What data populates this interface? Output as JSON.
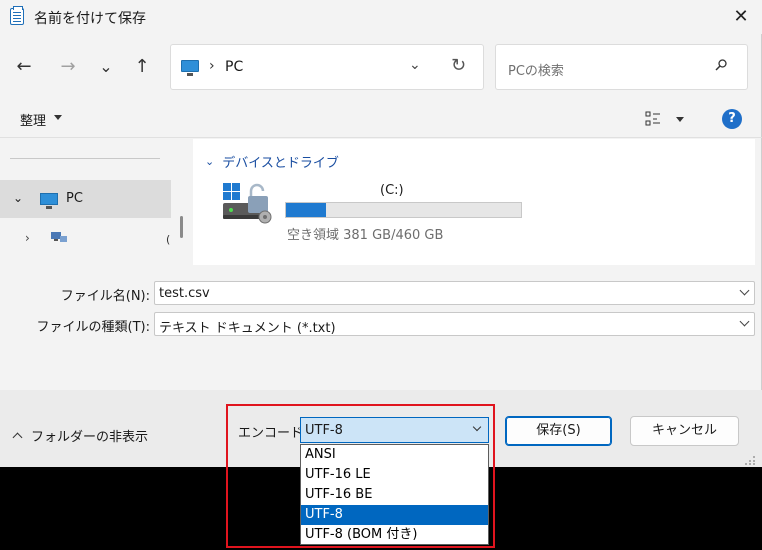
{
  "window": {
    "title": "名前を付けて保存",
    "close_glyph": "✕"
  },
  "nav": {
    "back_glyph": "←",
    "forward_glyph": "→",
    "recent_glyph": "⌄",
    "up_glyph": "↑",
    "address_separator": "›",
    "address_path": "PC",
    "address_dropdown_glyph": "⌄",
    "refresh_glyph": "↻",
    "search_placeholder": "PCの検索"
  },
  "commandbar": {
    "organize_label": "整理",
    "help_label": "?"
  },
  "navpane": {
    "pc_label": "PC",
    "expanded_glyph": "⌄",
    "collapsed_glyph": "›",
    "network_clip": "("
  },
  "content": {
    "group_label": "デバイスとドライブ",
    "group_glyph": "⌄",
    "drive_name": "(C:)",
    "drive_used_fraction": 0.17,
    "drive_space_text": "空き領域 381 GB/460 GB"
  },
  "form": {
    "filename_label": "ファイル名(N):",
    "filename_value": "test.csv",
    "filetype_label": "ファイルの種類(T):",
    "filetype_value": "テキスト ドキュメント (*.txt)"
  },
  "bottom": {
    "hide_folders_label": "フォルダーの非表示",
    "encoding_label": "エンコード:",
    "encoding_value": "UTF-8",
    "save_button": "保存(S)",
    "cancel_button": "キャンセル"
  },
  "encoding_options": [
    {
      "label": "ANSI",
      "selected": false
    },
    {
      "label": "UTF-16 LE",
      "selected": false
    },
    {
      "label": "UTF-16 BE",
      "selected": false
    },
    {
      "label": "UTF-8",
      "selected": true
    },
    {
      "label": "UTF-8 (BOM 付き)",
      "selected": false
    }
  ],
  "colors": {
    "accent": "#0067c0",
    "highlight_frame": "#e0141e",
    "drive_bar_fill": "#1f7ad0"
  }
}
